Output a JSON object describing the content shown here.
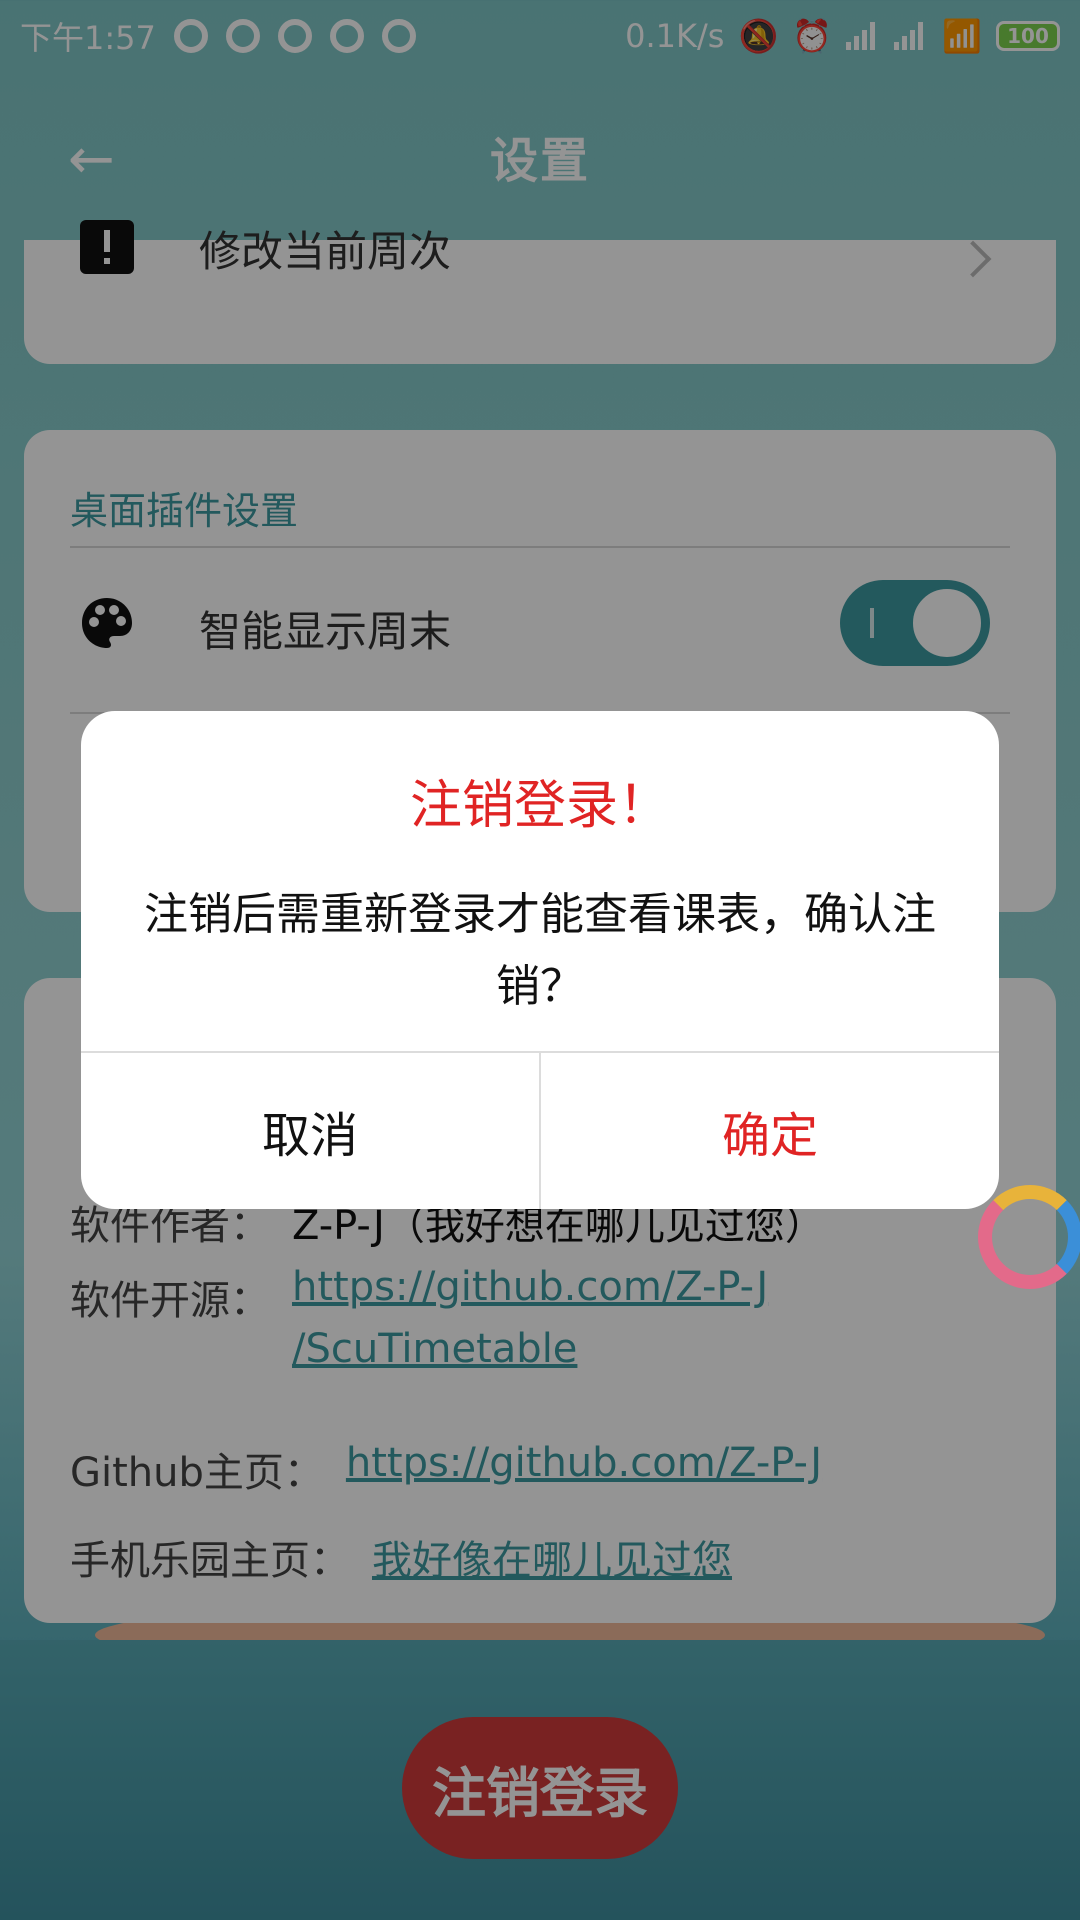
{
  "status_bar": {
    "time": "下午1:57",
    "network_speed": "0.1K/s",
    "battery": "100"
  },
  "toolbar": {
    "title": "设置"
  },
  "settings": {
    "row_current_week": "修改当前周次",
    "widget_section_title": "桌面插件设置",
    "row_smart_weekend": "智能显示周末",
    "smart_weekend_on": true
  },
  "about": {
    "author_label": "软件作者：",
    "author_value": "Z-P-J（我好想在哪儿见过您）",
    "opensource_label": "软件开源：",
    "opensource_link_line1": "https://github.com/Z-P-J",
    "opensource_link_line2": "/ScuTimetable",
    "github_label": "Github主页：",
    "github_link": "https://github.com/Z-P-J",
    "coolapk_label": "手机乐园主页：",
    "coolapk_link": "我好像在哪儿见过您"
  },
  "logout_button": "注销登录",
  "dialog": {
    "title": "注销登录！",
    "message": "注销后需重新登录才能查看课表，确认注销？",
    "cancel": "取消",
    "confirm": "确定"
  },
  "colors": {
    "accent": "#3d9aa0",
    "danger": "#e02424",
    "logout_bg": "#d03b3b"
  }
}
